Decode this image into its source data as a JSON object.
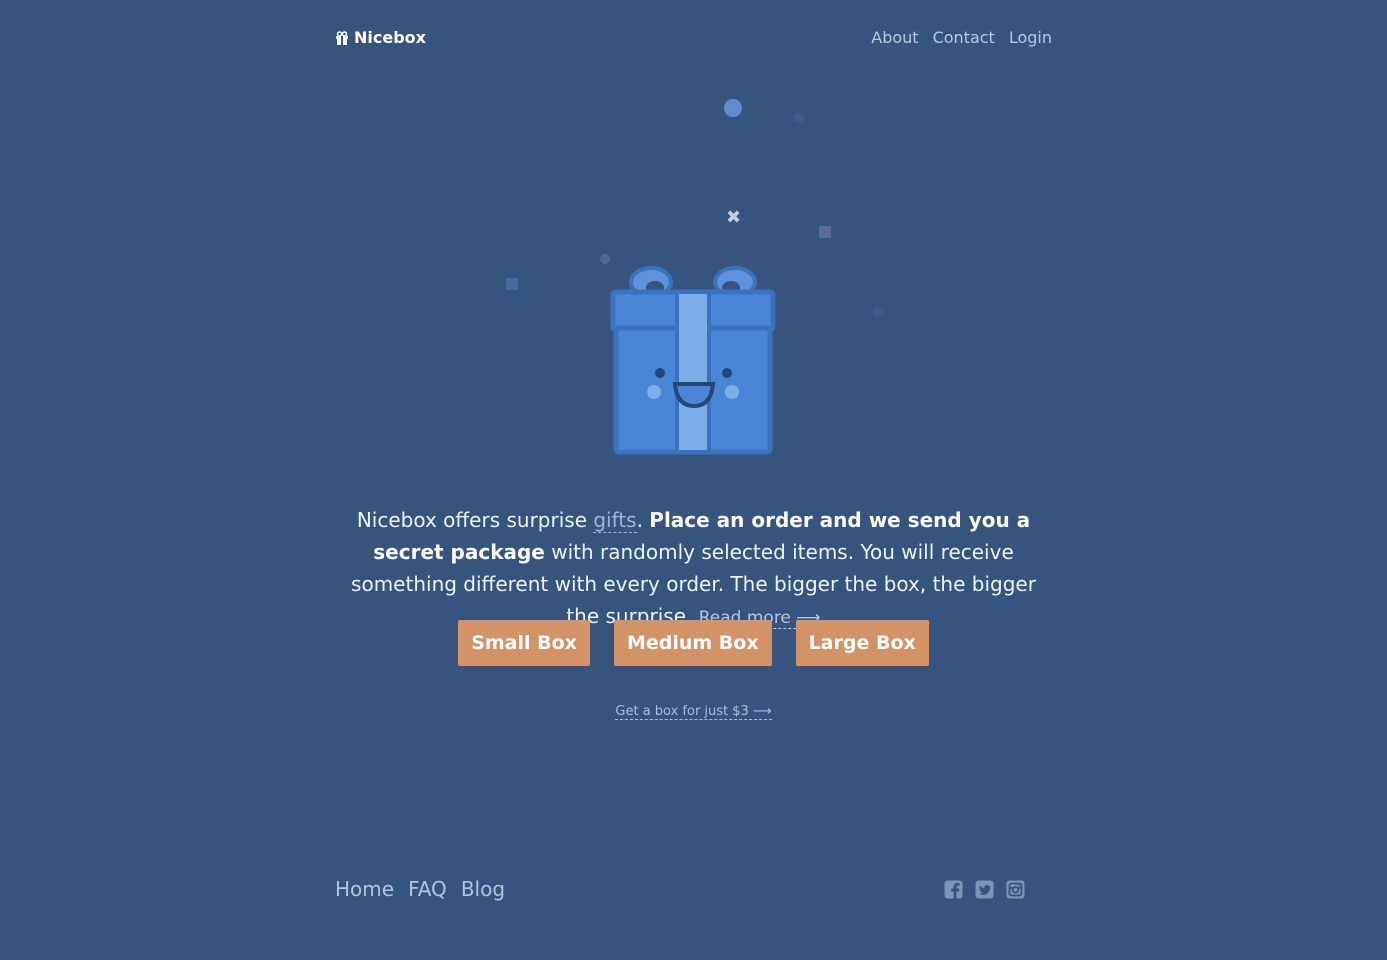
{
  "header": {
    "brand": "Nicebox",
    "nav": [
      "About",
      "Contact",
      "Login"
    ]
  },
  "intro": {
    "part1": "Nicebox offers surprise ",
    "gifts_link": "gifts",
    "part2": ". ",
    "bold": "Place an order and we send you a secret package",
    "part3": " with randomly selected items. You will receive something different with every order. The bigger the box, the bigger the surprise. ",
    "read_more": "Read more ⟶"
  },
  "buttons": {
    "small": "Small Box",
    "medium": "Medium Box",
    "large": "Large Box"
  },
  "promo": "Get a box for just $3 ⟶",
  "footer": {
    "nav": [
      "Home",
      "FAQ",
      "Blog"
    ],
    "social": [
      "facebook-icon",
      "twitter-icon",
      "instagram-icon"
    ]
  },
  "colors": {
    "background": "#37547f",
    "button": "#d49366",
    "gift": "#4a86d8"
  }
}
